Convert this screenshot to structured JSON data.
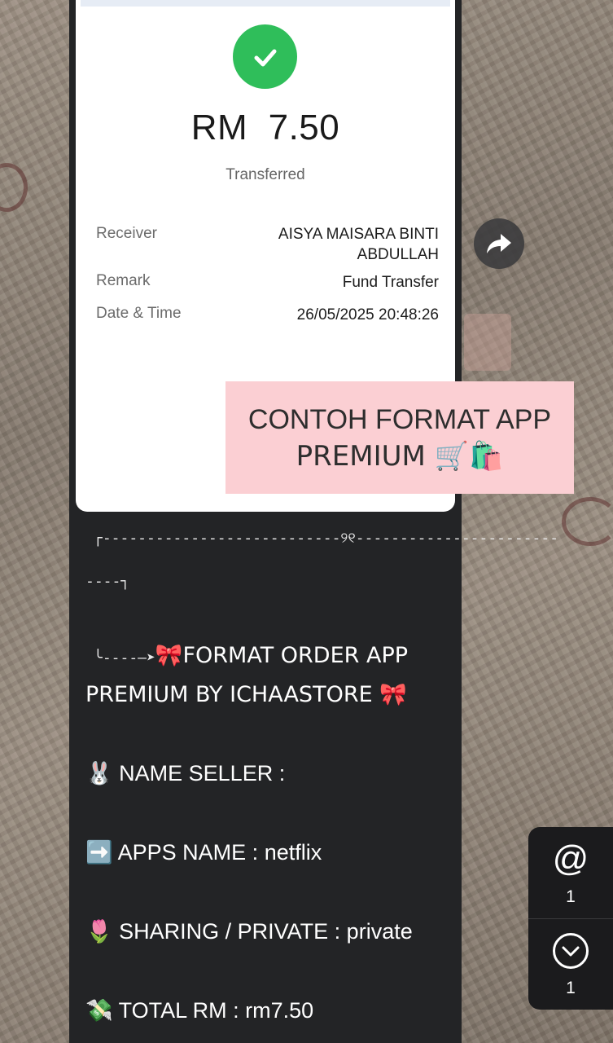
{
  "receipt": {
    "amount": "RM  7.50",
    "status": "Transferred",
    "rows": [
      {
        "label": "Receiver",
        "value_line1": "AISYA MAISARA BINTI",
        "value_line2": "ABDULLAH"
      },
      {
        "label": "Remark",
        "value": "Fund Transfer"
      },
      {
        "label": "Date & Time",
        "value": "26/05/2025 20:48:26"
      }
    ]
  },
  "sticker": {
    "line1": "CONTOH FORMAT APP",
    "line2": "PREMIUM 🛒🛍️"
  },
  "message": {
    "divider_top": "┌---------------------------୨୧-----------------------",
    "divider_cont": "----┐",
    "arrow": "╰----—➤",
    "order_title_1": "🎀FORMAT ORDER  APP",
    "order_title_2": "PREMIUM BY ICHAASTORE 🎀",
    "fields": [
      {
        "emoji": "🐰",
        "text": "NAME SELLER :"
      },
      {
        "emoji": "➡️",
        "text": "APPS NAME : netflix"
      },
      {
        "emoji": "🌷",
        "text": "SHARING / PRIVATE : private"
      },
      {
        "emoji": "💸",
        "text": "TOTAL RM : rm7.50"
      }
    ]
  },
  "side_panel": {
    "mentions_icon": "@",
    "mentions_count": "1",
    "scroll_down_count": "1"
  },
  "icons": {
    "check": "check-icon",
    "share": "share-arrow-icon",
    "scroll": "chevron-down-icon"
  },
  "colors": {
    "success": "#2fbe5a",
    "sticker_bg": "#fbcfd3",
    "chat_bg": "#232426"
  }
}
